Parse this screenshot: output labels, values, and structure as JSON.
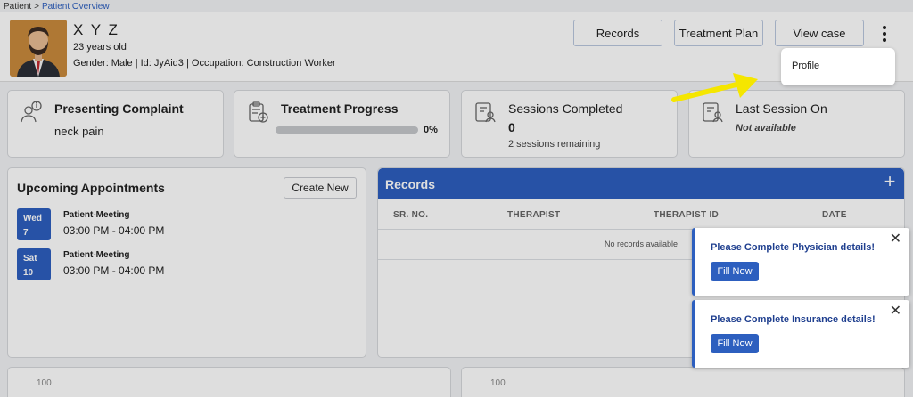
{
  "breadcrumb": {
    "root": "Patient",
    "separator": ">",
    "current": "Patient Overview"
  },
  "patient": {
    "name": "X Y Z",
    "age": "23 years old",
    "info": "Gender: Male | Id: JyAiq3 | Occupation: Construction Worker"
  },
  "header_buttons": {
    "records": "Records",
    "treatment_plan": "Treatment Plan",
    "view_case": "View case"
  },
  "dropdown": {
    "items": [
      {
        "label": "Profile"
      }
    ]
  },
  "stats": {
    "presenting_complaint": {
      "title": "Presenting Complaint",
      "value": "neck pain"
    },
    "treatment_progress": {
      "title": "Treatment Progress",
      "percent": 0,
      "percent_label": "0%"
    },
    "sessions_completed": {
      "title": "Sessions Completed",
      "value": "0",
      "remaining": "2 sessions remaining"
    },
    "last_session": {
      "title": "Last Session On",
      "value": "Not available"
    }
  },
  "appointments": {
    "title": "Upcoming Appointments",
    "create_label": "Create New",
    "items": [
      {
        "day": "Wed",
        "date": "7",
        "title": "Patient-Meeting",
        "time": "03:00 PM - 04:00 PM"
      },
      {
        "day": "Sat",
        "date": "10",
        "title": "Patient-Meeting",
        "time": "03:00 PM - 04:00 PM"
      }
    ]
  },
  "records": {
    "title": "Records",
    "columns": [
      "SR. NO.",
      "THERAPIST",
      "THERAPIST ID",
      "DATE"
    ],
    "empty_text": "No records available"
  },
  "toasts": [
    {
      "message": "Please Complete Physician details!",
      "action": "Fill Now"
    },
    {
      "message": "Please Complete Insurance details!",
      "action": "Fill Now"
    }
  ],
  "charts": {
    "left_label": "100",
    "right_label": "100"
  },
  "colors": {
    "accent": "#2d5fbf",
    "arrow": "#f5e600"
  }
}
